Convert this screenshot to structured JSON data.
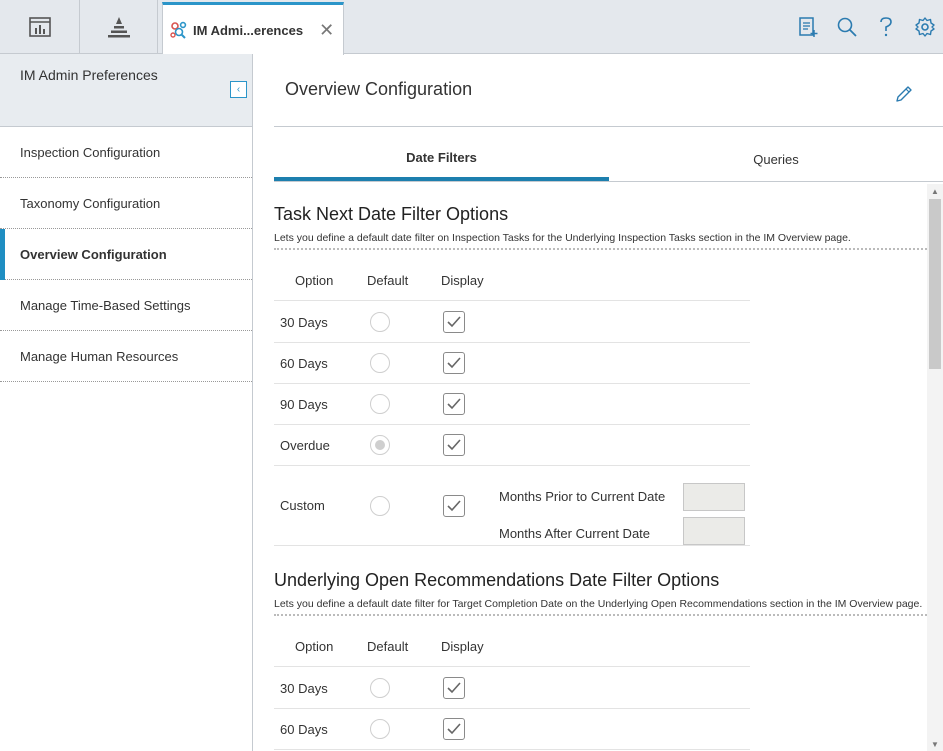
{
  "topbar": {
    "dashboard_icon": "dashboard-icon",
    "asset_hierarchy_icon": "hierarchy-icon",
    "active_tab": {
      "title": "IM Admi...erences",
      "icon": "inspection-management-icon",
      "close_glyph": "✕"
    },
    "right_icons": [
      "report-icon",
      "search-icon",
      "help-icon",
      "gear-icon"
    ]
  },
  "sidebar": {
    "title": "IM Admin Preferences",
    "collapse_glyph": "‹",
    "items": [
      {
        "label": "Inspection Configuration",
        "active": false
      },
      {
        "label": "Taxonomy Configuration",
        "active": false
      },
      {
        "label": "Overview Configuration",
        "active": true
      },
      {
        "label": "Manage Time-Based Settings",
        "active": false
      },
      {
        "label": "Manage Human Resources",
        "active": false
      }
    ]
  },
  "main": {
    "title": "Overview Configuration",
    "tabs": [
      {
        "label": "Date Filters",
        "selected": true
      },
      {
        "label": "Queries",
        "selected": false
      }
    ],
    "columns": {
      "option": "Option",
      "default": "Default",
      "display": "Display"
    },
    "sections": [
      {
        "title": "Task Next Date Filter Options",
        "description": "Lets you define a default date filter on Inspection Tasks for the Underlying Inspection Tasks section in the IM Overview page.",
        "rows": [
          {
            "label": "30 Days",
            "default": false,
            "display": true
          },
          {
            "label": "60 Days",
            "default": false,
            "display": true
          },
          {
            "label": "90 Days",
            "default": false,
            "display": true
          },
          {
            "label": "Overdue",
            "default": true,
            "display": true
          },
          {
            "label": "Custom",
            "default": false,
            "display": true
          }
        ],
        "custom_fields": [
          {
            "label": "Months Prior to Current Date",
            "value": ""
          },
          {
            "label": "Months After Current Date",
            "value": ""
          }
        ]
      },
      {
        "title": "Underlying Open Recommendations Date Filter Options",
        "description": "Lets you define a default date filter for Target Completion Date on the Underlying Open Recommendations section in the IM Overview page.",
        "rows": [
          {
            "label": "30 Days",
            "default": false,
            "display": true
          },
          {
            "label": "60 Days",
            "default": false,
            "display": true
          }
        ]
      }
    ]
  },
  "colors": {
    "accent": "#1f8ec2",
    "tab_underline": "#1d7fae",
    "topbar_bg": "#e4e8ed",
    "sidebar_header_bg": "#e8ecf0"
  }
}
